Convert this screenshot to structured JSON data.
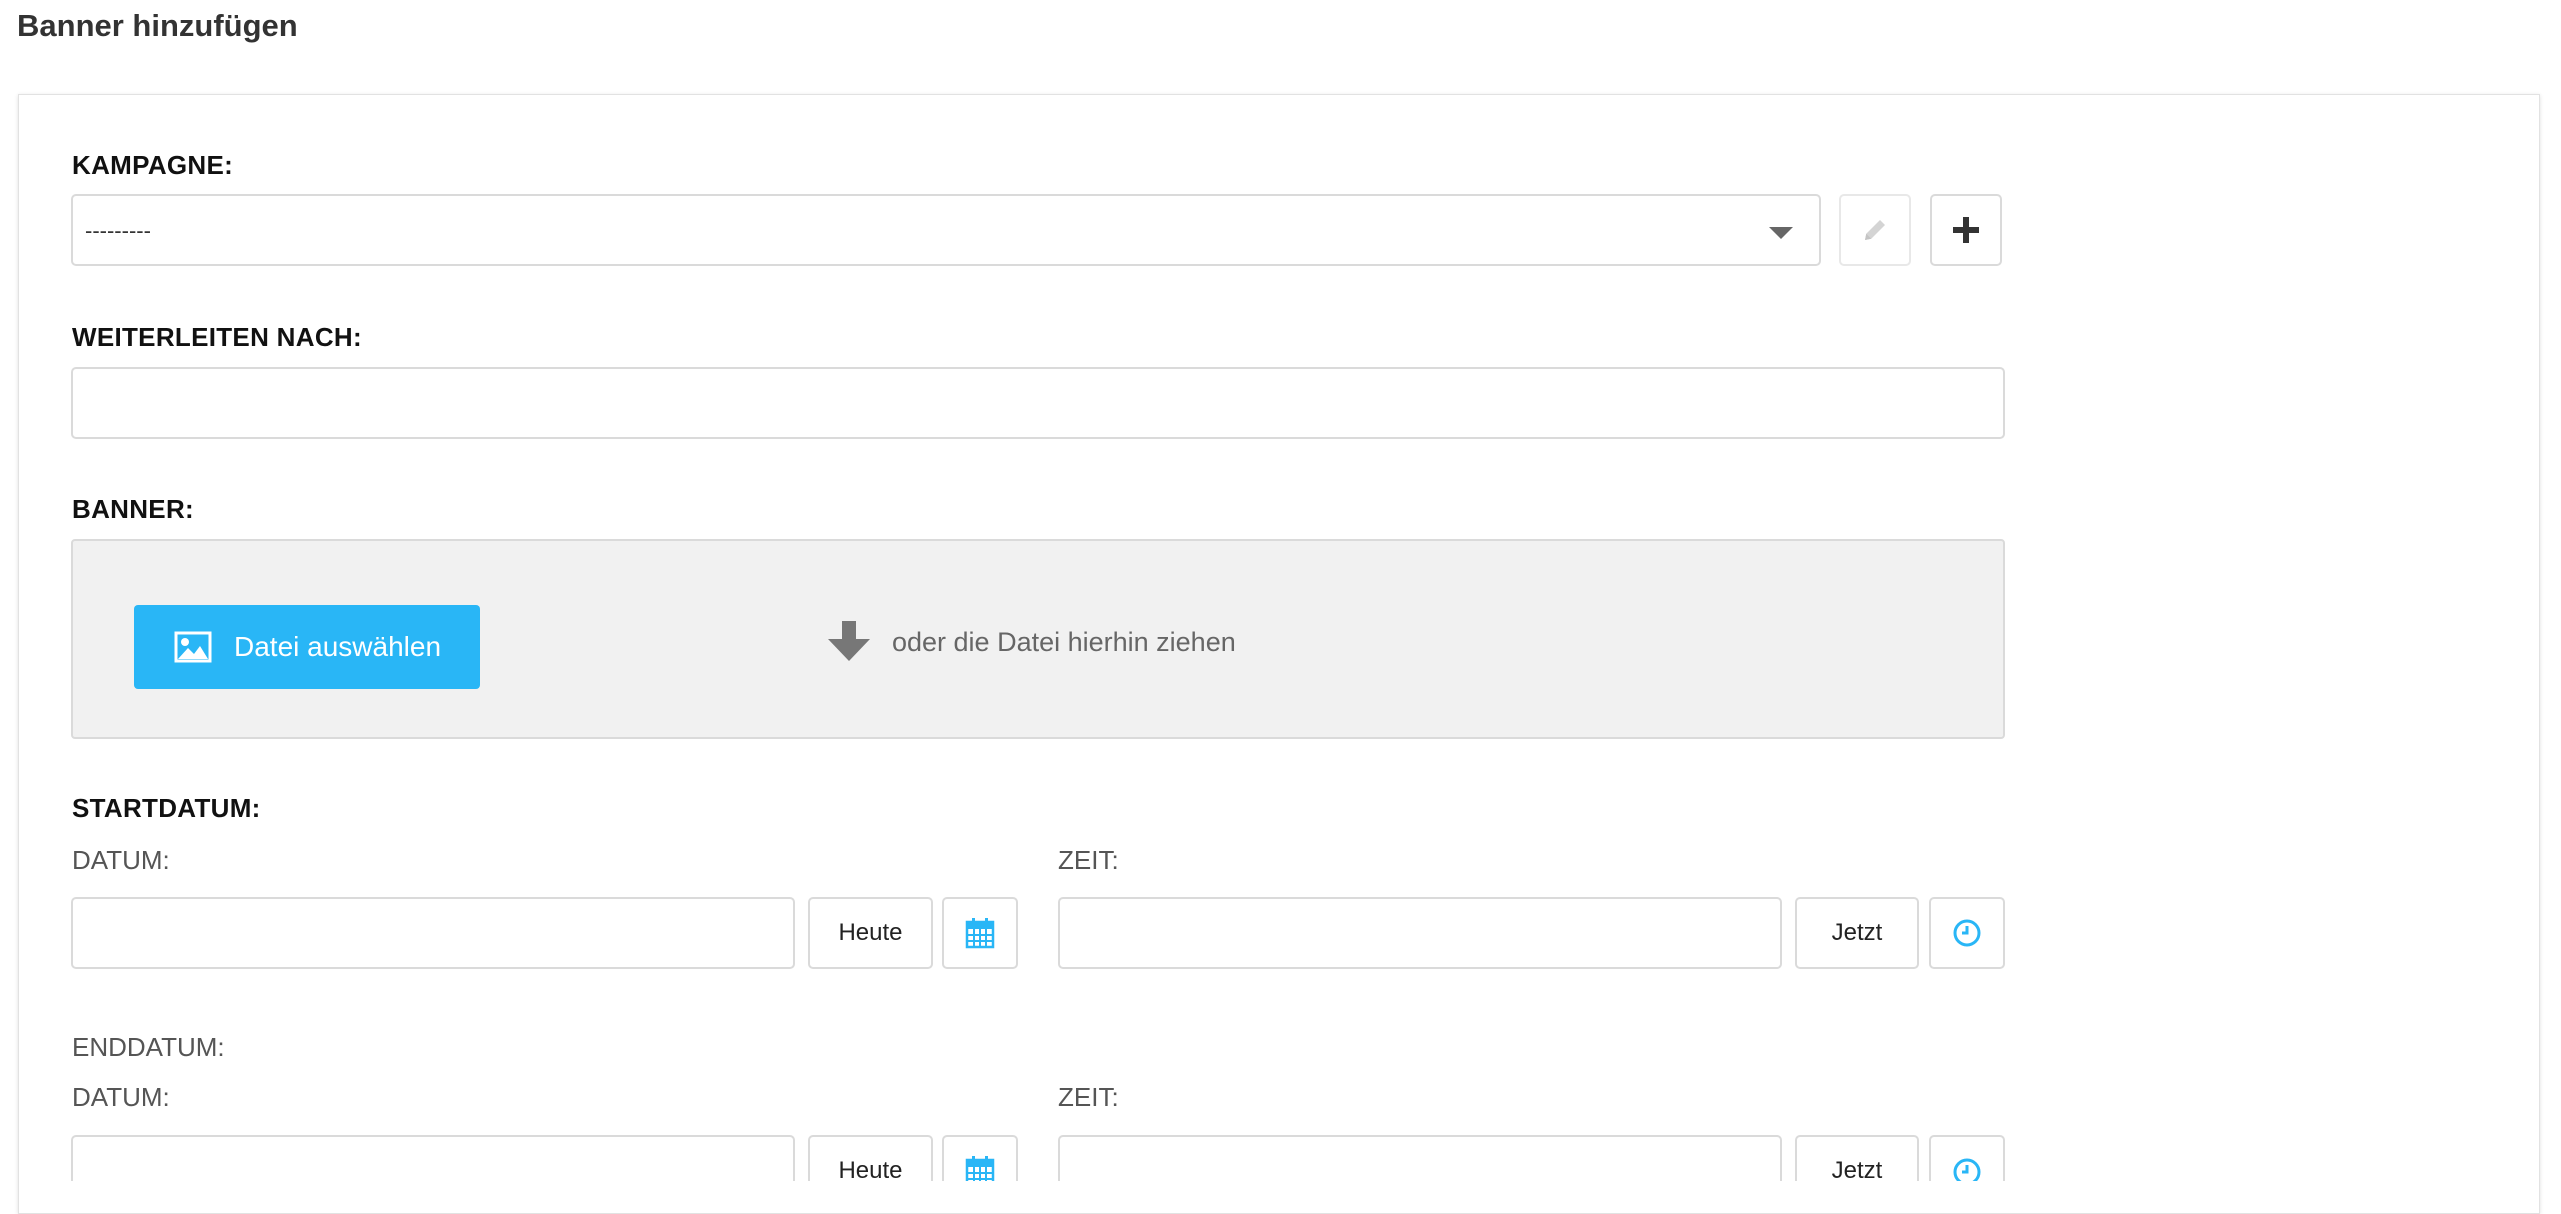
{
  "page": {
    "title": "Banner hinzufügen"
  },
  "campaign": {
    "label": "KAMPAGNE:",
    "selected": "---------"
  },
  "redirect": {
    "label": "WEITERLEITEN NACH:",
    "value": ""
  },
  "banner": {
    "label": "BANNER:",
    "select_file_label": "Datei auswählen",
    "drop_hint": "oder die Datei hierhin ziehen"
  },
  "start": {
    "label": "STARTDATUM:",
    "date_label": "DATUM:",
    "time_label": "ZEIT:",
    "date_value": "",
    "time_value": "",
    "today_label": "Heute",
    "now_label": "Jetzt"
  },
  "end": {
    "label": "ENDDATUM:",
    "date_label": "DATUM:",
    "time_label": "ZEIT:",
    "date_value": "",
    "time_value": "",
    "today_label": "Heute",
    "now_label": "Jetzt"
  },
  "colors": {
    "accent": "#29b6f6",
    "icon_accent": "#29b6f6",
    "dropzone_bg": "#f1f1f1",
    "border": "#dadada"
  },
  "icons": {
    "campaign_select": "chevron-down-icon",
    "edit": "pencil-icon",
    "add": "plus-icon",
    "file": "image-icon",
    "drop": "arrow-down-icon",
    "calendar": "calendar-icon",
    "clock": "clock-icon"
  }
}
